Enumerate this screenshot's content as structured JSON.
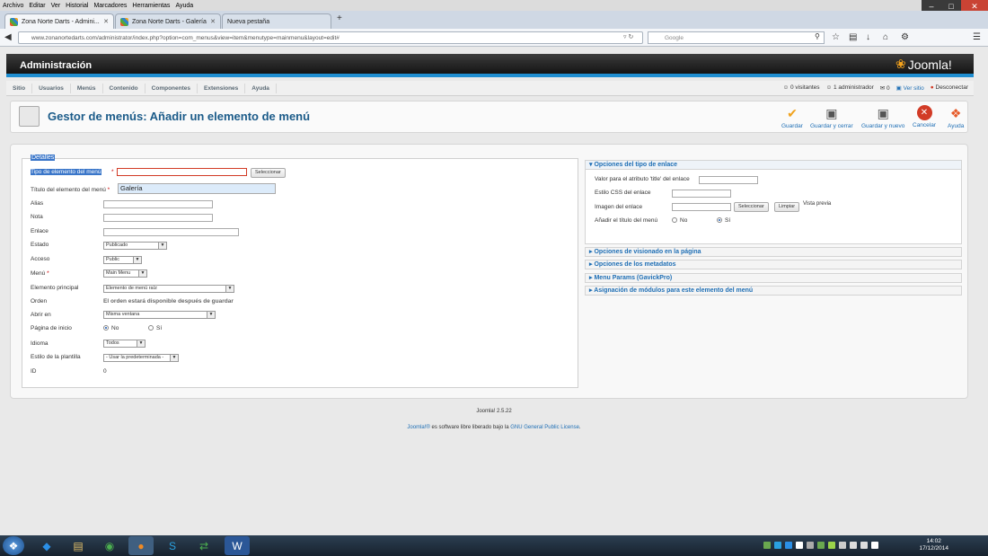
{
  "browser": {
    "menu": [
      "Archivo",
      "Editar",
      "Ver",
      "Historial",
      "Marcadores",
      "Herramientas",
      "Ayuda"
    ],
    "tabs": [
      {
        "label": "Zona Norte Darts - Admini..."
      },
      {
        "label": "Zona Norte Darts - Galería"
      },
      {
        "label": "Nueva pestaña"
      }
    ],
    "new_tab": "+",
    "url": "www.zonanortedarts.com/administrator/index.php?option=com_menus&view=item&menutype=mainmenu&layout=edit#",
    "search_placeholder": "Google"
  },
  "header": {
    "title": "Administración",
    "logo_text": "Joomla!"
  },
  "submenu": [
    "Sitio",
    "Usuarios",
    "Menús",
    "Contenido",
    "Componentes",
    "Extensiones",
    "Ayuda"
  ],
  "status": {
    "visitors": "0 visitantes",
    "admins": "1 administrador",
    "messages": "0",
    "view_site": "Ver sitio",
    "logout": "Desconectar"
  },
  "toolbar": {
    "title": "Gestor de menús: Añadir un elemento de menú",
    "buttons": [
      "Guardar",
      "Guardar y cerrar",
      "Guardar y nuevo",
      "Cancelar",
      "Ayuda"
    ]
  },
  "details": {
    "legend": "Detalles",
    "type_label": "Tipo de elemento del menú",
    "type_button": "Seleccionar",
    "title_label": "Título del elemento del menú",
    "title_value": "Galería",
    "alias_label": "Alias",
    "note_label": "Nota",
    "link_label": "Enlace",
    "state_label": "Estado",
    "state_value": "Publicado",
    "access_label": "Acceso",
    "access_value": "Public",
    "menu_label": "Menú",
    "menu_value": "Main Menu",
    "parent_label": "Elemento principal",
    "parent_value": "Elemento de menú raíz",
    "order_label": "Orden",
    "order_value": "El orden estará disponible después de guardar",
    "open_label": "Abrir en",
    "open_value": "Misma ventana",
    "home_label": "Página de inicio",
    "home_no": "No",
    "home_yes": "Sí",
    "lang_label": "Idioma",
    "lang_value": "Todos",
    "template_label": "Estilo de la plantilla",
    "template_value": "- Usar la predeterminada -",
    "id_label": "ID",
    "id_value": "0",
    "required_mark": "*"
  },
  "options": {
    "link_type_header": "Opciones del tipo de enlace",
    "title_attr_label": "Valor para el atributo 'title' del enlace",
    "css_label": "Estilo CSS del enlace",
    "image_label": "Imagen del enlace",
    "image_select": "Seleccionar",
    "image_clear": "Limpiar",
    "preview": "Vista previa",
    "add_title_label": "Añadir el título del menú",
    "add_title_no": "No",
    "add_title_yes": "Sí",
    "accordion": [
      "Opciones de visionado en la página",
      "Opciones de los metadatos",
      "Menu Params (GavickPro)",
      "Asignación de módulos para este elemento del menú"
    ]
  },
  "footer": {
    "version": "Joomla! 2.5.22",
    "license_pre": "Joomla!®",
    "license_mid": " es software libre liberado bajo la ",
    "license_link": "GNU General Public License",
    "license_end": "."
  },
  "taskbar": {
    "time": "14:02",
    "date": "17/12/2014"
  },
  "colors": {
    "accent": "#1f8ed1",
    "link": "#1f6fb5",
    "title": "#1b5b89",
    "error": "#d23b26",
    "save": "#f0a21d"
  }
}
